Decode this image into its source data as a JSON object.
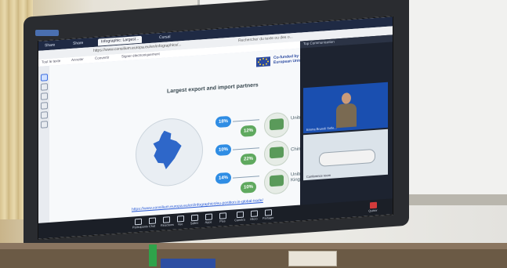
{
  "browser": {
    "tabs": [
      "Share",
      "Infographic: Largest...",
      "Cursal"
    ],
    "url_text": "https://www.consilium.europa.eu/en/infographics/...",
    "search_hint": "Rechercher du texte ou des o...",
    "panel_title": "Top Communication"
  },
  "toolbar": {
    "items": [
      "Tout le texte",
      "Annoter",
      "Convertir",
      "Signer électroniquement"
    ]
  },
  "slide": {
    "eu_logo_text": "Co-funded by the European Union",
    "title": "Largest export and import partners",
    "partners": [
      {
        "name": "United States",
        "export": "18%",
        "import": "12%"
      },
      {
        "name": "China",
        "export": "10%",
        "import": "22%"
      },
      {
        "name": "United Kingdom",
        "export": "14%",
        "import": "10%"
      }
    ],
    "source_link": "https://www.consilium.europa.eu/en/infographics/eu-position-in-global-trade/"
  },
  "call": {
    "video1_caption": "Emma Brunoli Sofie...",
    "video2_caption": "Conference room"
  },
  "controls": [
    {
      "label": "Participants"
    },
    {
      "label": "Chat"
    },
    {
      "label": "Réactions"
    },
    {
      "label": "Vue"
    },
    {
      "label": "Salles"
    },
    {
      "label": "Apps"
    },
    {
      "label": "Plus"
    },
    {
      "label": "Caméra"
    },
    {
      "label": "Micro"
    },
    {
      "label": "Partager"
    },
    {
      "label": "Quitter"
    }
  ],
  "colors": {
    "export_badge": "#2f8de4",
    "import_badge": "#5fa95f",
    "eu_blue": "#2b4aa0",
    "leave_red": "#d43b3b"
  }
}
